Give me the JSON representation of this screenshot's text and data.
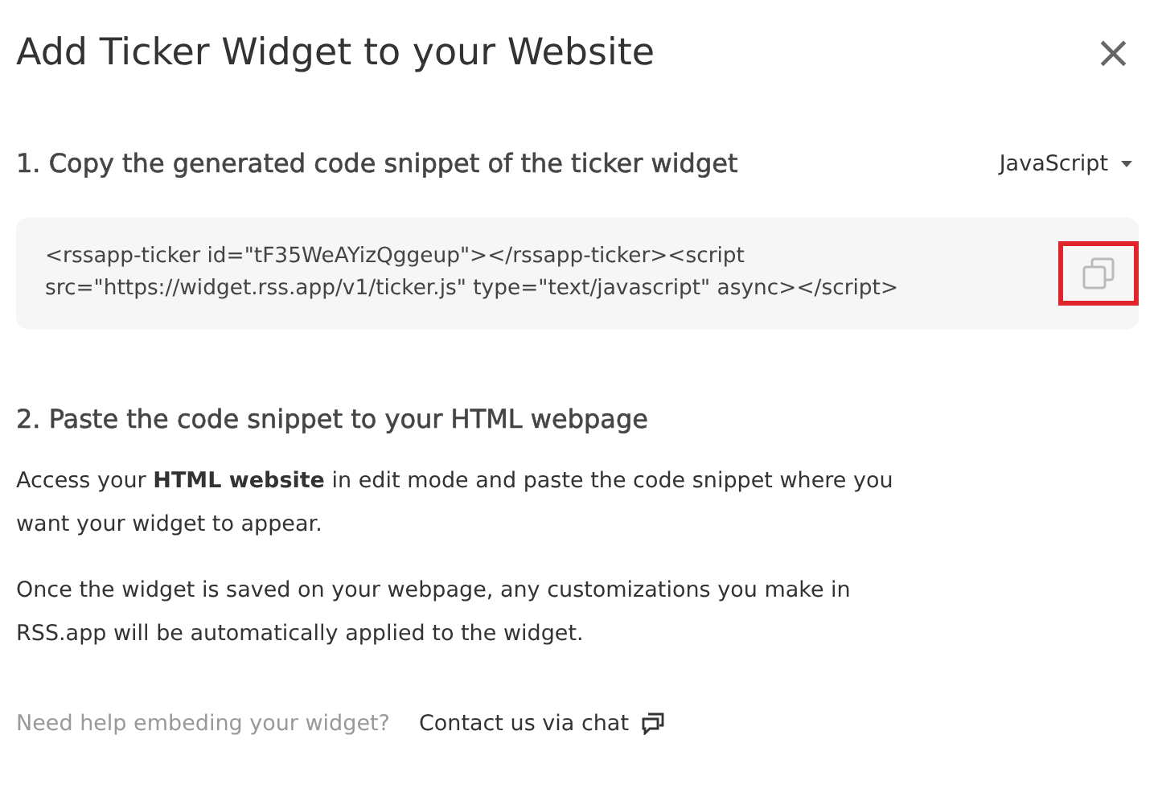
{
  "dialog": {
    "title": "Add Ticker Widget to your Website",
    "close": "×"
  },
  "step1": {
    "heading": "1. Copy the generated code snippet of the ticker widget",
    "language": "JavaScript",
    "code_lines": [
      "<rssapp-ticker id=\"tF35WeAYizQggeup\"></rssapp-ticker><script",
      "src=\"https://widget.rss.app/v1/ticker.js\" type=\"text/javascript\" async></script>"
    ],
    "copy_highlighted": true
  },
  "step2": {
    "heading": "2. Paste the code snippet to your HTML webpage",
    "paragraphs": [
      "Access your **HTML website** in edit mode and paste the code snippet where you want your widget to appear.",
      "Once the widget is saved on your webpage, any customizations you make in RSS.app will be automatically applied to the widget."
    ]
  },
  "footer": {
    "help": "Need help embeding your widget?",
    "link": "Contact us via chat"
  }
}
